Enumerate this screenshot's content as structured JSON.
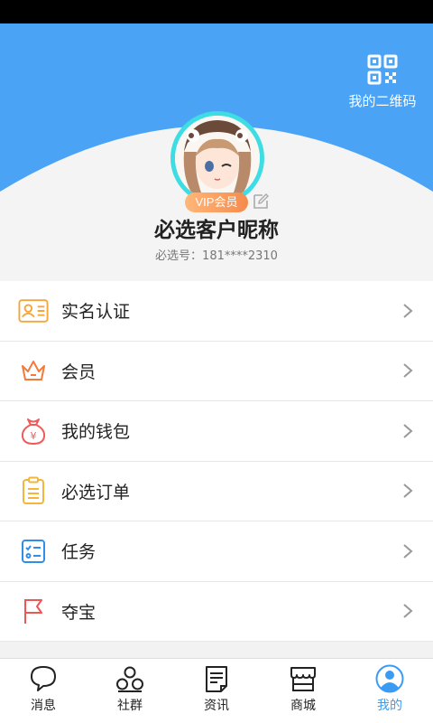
{
  "header": {
    "qr_label": "我的二维码",
    "vip_label": "VIP会员",
    "nickname": "必选客户昵称",
    "account": "必选号：181****2310"
  },
  "menu": [
    {
      "label": "实名认证",
      "icon": "id-card-icon"
    },
    {
      "label": "会员",
      "icon": "crown-icon"
    },
    {
      "label": "我的钱包",
      "icon": "money-bag-icon"
    },
    {
      "label": "必选订单",
      "icon": "clipboard-icon"
    },
    {
      "label": "任务",
      "icon": "task-list-icon"
    },
    {
      "label": "夺宝",
      "icon": "flag-icon"
    }
  ],
  "tabs": [
    {
      "label": "消息",
      "icon": "chat-bubble-icon",
      "active": false
    },
    {
      "label": "社群",
      "icon": "group-icon",
      "active": false
    },
    {
      "label": "资讯",
      "icon": "news-icon",
      "active": false
    },
    {
      "label": "商城",
      "icon": "store-icon",
      "active": false
    },
    {
      "label": "我的",
      "icon": "profile-icon",
      "active": true
    }
  ],
  "colors": {
    "header_blue": "#4aa3f5",
    "accent": "#3a9bf5",
    "vip_gradient_start": "#ffb77a",
    "vip_gradient_end": "#f58b4c",
    "avatar_ring": "#3ddde3"
  }
}
